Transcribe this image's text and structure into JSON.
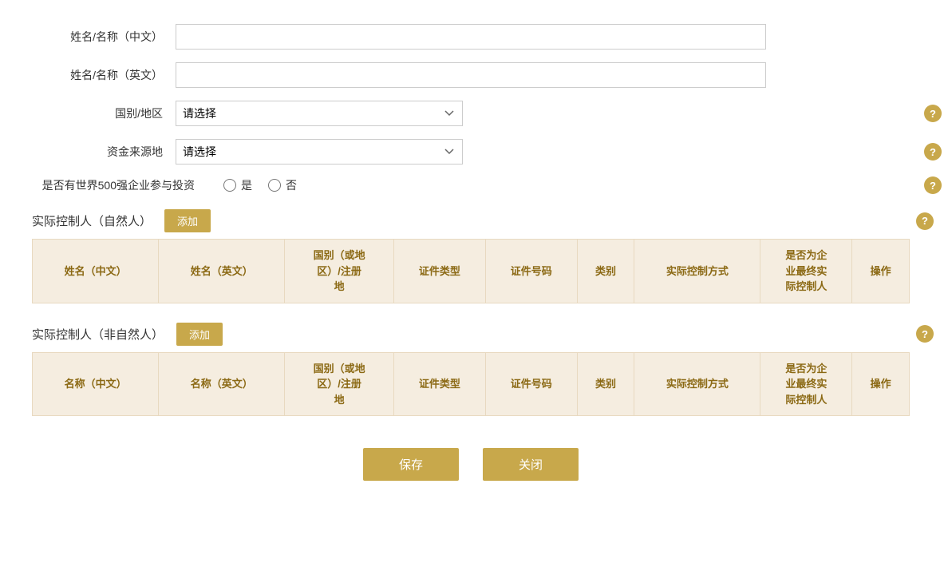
{
  "form": {
    "name_cn_label": "姓名/名称（中文）",
    "name_en_label": "姓名/名称（英文）",
    "country_label": "国别/地区",
    "country_placeholder": "请选择",
    "fund_source_label": "资金来源地",
    "fund_source_placeholder": "请选择",
    "fortune500_label": "是否有世界500强企业参与投资",
    "fortune500_yes": "是",
    "fortune500_no": "否",
    "name_cn_value": "",
    "name_en_value": ""
  },
  "natural_person_section": {
    "title": "实际控制人（自然人）",
    "add_label": "添加",
    "columns": [
      "姓名（中文）",
      "姓名（英文）",
      "国别（或地\n区）/注册\n地",
      "证件类型",
      "证件号码",
      "类别",
      "实际控制方式",
      "是否为企\n业最终实\n际控制人",
      "操作"
    ]
  },
  "non_natural_person_section": {
    "title": "实际控制人（非自然人）",
    "add_label": "添加",
    "columns": [
      "名称（中文）",
      "名称（英文）",
      "国别（或地\n区）/注册\n地",
      "证件类型",
      "证件号码",
      "类别",
      "实际控制方式",
      "是否为企\n业最终实\n际控制人",
      "操作"
    ]
  },
  "buttons": {
    "save": "保存",
    "close": "关闭"
  },
  "help_icon": "?",
  "icons": {
    "dropdown_arrow": "▾"
  }
}
